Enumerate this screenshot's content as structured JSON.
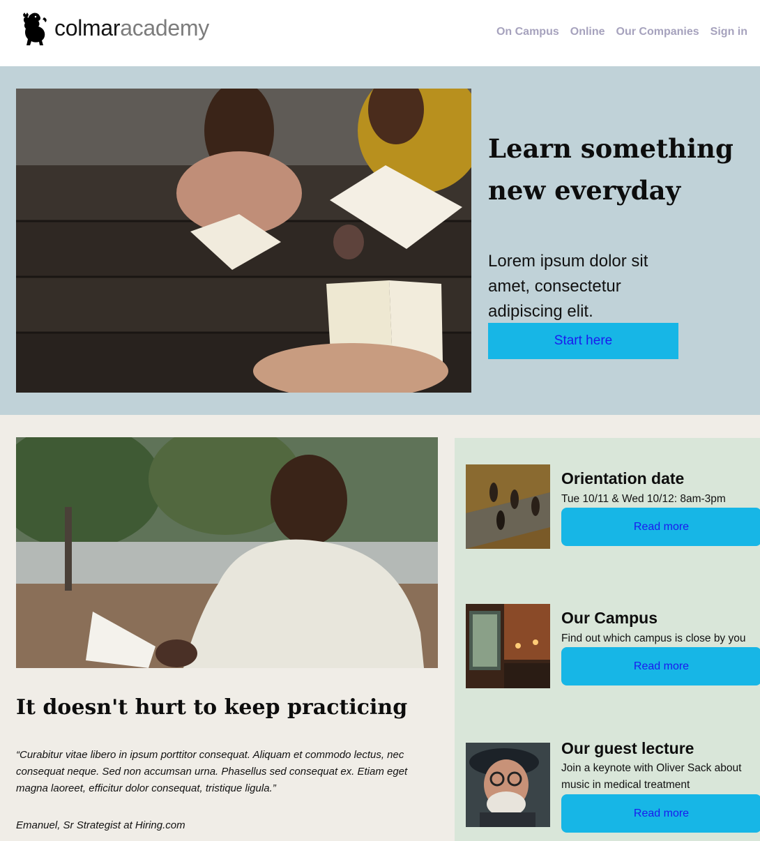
{
  "header": {
    "logo_main": "colmar",
    "logo_accent": "academy",
    "nav": [
      "On Campus",
      "Online",
      "Our Companies",
      "Sign in"
    ]
  },
  "hero": {
    "title": "Learn something new everyday",
    "text": "Lorem ipsum dolor sit amet, consectetur adipiscing elit.",
    "button": "Start here"
  },
  "feature": {
    "title": "It doesn't hurt to keep practicing",
    "quote": "“Curabitur vitae libero in ipsum porttitor consequat. Aliquam et commodo lectus, nec consequat neque. Sed non accumsan urna. Phasellus sed consequat ex. Etiam eget magna laoreet, efficitur dolor consequat, tristique ligula.”",
    "author": "Emanuel, Sr Strategist at Hiring.com"
  },
  "cards": [
    {
      "title": "Orientation date",
      "desc": "Tue 10/11 & Wed 10/12: 8am-3pm",
      "button": "Read more"
    },
    {
      "title": "Our Campus",
      "desc": "Find out which campus is close by you",
      "button": "Read more"
    },
    {
      "title": "Our guest lecture",
      "desc": "Join a keynote with Oliver Sack about music in medical treatment",
      "button": "Read more"
    }
  ],
  "colors": {
    "hero_bg": "#c0d2d8",
    "lower_bg": "#f0ede7",
    "sidebar_bg": "#d9e6d9",
    "button": "#17b6e6",
    "button_text": "#1a1aee",
    "nav_text": "#a6a2bd"
  }
}
